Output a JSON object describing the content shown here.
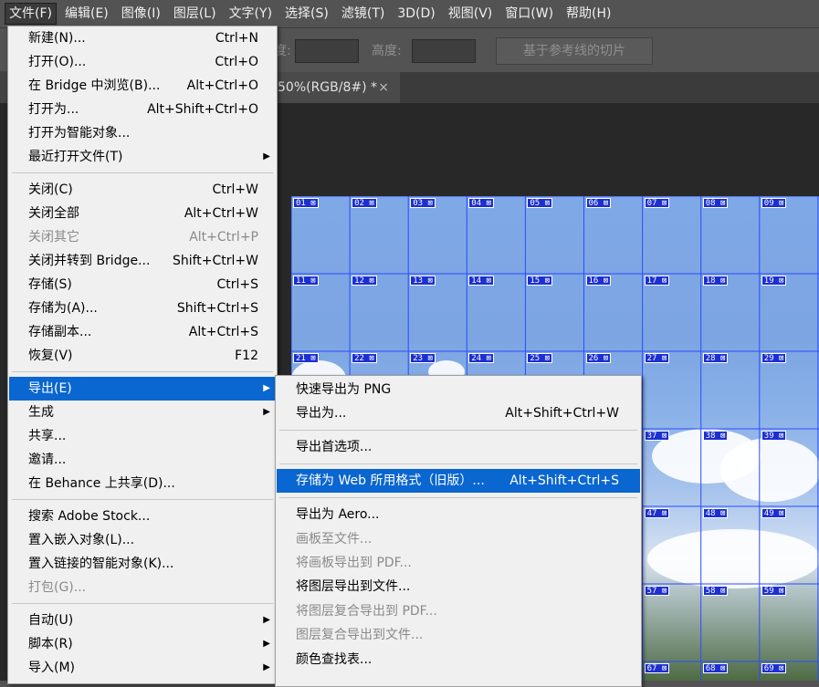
{
  "menubar": {
    "items": [
      {
        "label": "文件(F)",
        "active": true
      },
      {
        "label": "编辑(E)"
      },
      {
        "label": "图像(I)"
      },
      {
        "label": "图层(L)"
      },
      {
        "label": "文字(Y)"
      },
      {
        "label": "选择(S)"
      },
      {
        "label": "滤镜(T)"
      },
      {
        "label": "3D(D)"
      },
      {
        "label": "视图(V)"
      },
      {
        "label": "窗口(W)"
      },
      {
        "label": "帮助(H)"
      }
    ]
  },
  "options": {
    "width_label_fragment": "度:",
    "height_label": "高度:",
    "slice_button": "基于参考线的切片"
  },
  "tab": {
    "title": "50%(RGB/8#) *",
    "close": "×"
  },
  "file_menu": {
    "items": [
      {
        "label": "新建(N)...",
        "shortcut": "Ctrl+N"
      },
      {
        "label": "打开(O)...",
        "shortcut": "Ctrl+O"
      },
      {
        "label": "在 Bridge 中浏览(B)...",
        "shortcut": "Alt+Ctrl+O"
      },
      {
        "label": "打开为...",
        "shortcut": "Alt+Shift+Ctrl+O"
      },
      {
        "label": "打开为智能对象...",
        "shortcut": ""
      },
      {
        "label": "最近打开文件(T)",
        "shortcut": "",
        "submenu": true
      },
      {
        "sep": true
      },
      {
        "label": "关闭(C)",
        "shortcut": "Ctrl+W"
      },
      {
        "label": "关闭全部",
        "shortcut": "Alt+Ctrl+W"
      },
      {
        "label": "关闭其它",
        "shortcut": "Alt+Ctrl+P",
        "disabled": true
      },
      {
        "label": "关闭并转到 Bridge...",
        "shortcut": "Shift+Ctrl+W"
      },
      {
        "label": "存储(S)",
        "shortcut": "Ctrl+S"
      },
      {
        "label": "存储为(A)...",
        "shortcut": "Shift+Ctrl+S"
      },
      {
        "label": "存储副本...",
        "shortcut": "Alt+Ctrl+S"
      },
      {
        "label": "恢复(V)",
        "shortcut": "F12"
      },
      {
        "sep": true
      },
      {
        "label": "导出(E)",
        "shortcut": "",
        "submenu": true,
        "highlighted": true
      },
      {
        "label": "生成",
        "shortcut": "",
        "submenu": true
      },
      {
        "label": "共享...",
        "shortcut": ""
      },
      {
        "label": "邀请...",
        "shortcut": ""
      },
      {
        "label": "在 Behance 上共享(D)...",
        "shortcut": ""
      },
      {
        "sep": true
      },
      {
        "label": "搜索 Adobe Stock...",
        "shortcut": ""
      },
      {
        "label": "置入嵌入对象(L)...",
        "shortcut": ""
      },
      {
        "label": "置入链接的智能对象(K)...",
        "shortcut": ""
      },
      {
        "label": "打包(G)...",
        "shortcut": "",
        "disabled": true
      },
      {
        "sep": true
      },
      {
        "label": "自动(U)",
        "shortcut": "",
        "submenu": true
      },
      {
        "label": "脚本(R)",
        "shortcut": "",
        "submenu": true
      },
      {
        "label": "导入(M)",
        "shortcut": "",
        "submenu": true
      }
    ]
  },
  "export_menu": {
    "items": [
      {
        "label": "快速导出为 PNG",
        "shortcut": ""
      },
      {
        "label": "导出为...",
        "shortcut": "Alt+Shift+Ctrl+W"
      },
      {
        "sep": true
      },
      {
        "label": "导出首选项...",
        "shortcut": ""
      },
      {
        "sep": true
      },
      {
        "label": "存储为 Web 所用格式（旧版）...",
        "shortcut": "Alt+Shift+Ctrl+S",
        "highlighted": true
      },
      {
        "sep": true
      },
      {
        "label": "导出为 Aero...",
        "shortcut": ""
      },
      {
        "label": "画板至文件...",
        "shortcut": "",
        "disabled": true
      },
      {
        "label": "将画板导出到 PDF...",
        "shortcut": "",
        "disabled": true
      },
      {
        "label": "将图层导出到文件...",
        "shortcut": ""
      },
      {
        "label": "将图层复合导出到 PDF...",
        "shortcut": "",
        "disabled": true
      },
      {
        "label": "图层复合导出到文件...",
        "shortcut": "",
        "disabled": true
      },
      {
        "label": "颜色查找表...",
        "shortcut": ""
      }
    ]
  },
  "slices": {
    "visible_labels": [
      "01",
      "02",
      "03",
      "04",
      "05",
      "06",
      "07",
      "08",
      "09",
      "11",
      "12",
      "13",
      "14",
      "15",
      "16",
      "17",
      "18",
      "19",
      "21",
      "22",
      "23",
      "24",
      "25",
      "26",
      "27",
      "28",
      "29",
      "37",
      "38",
      "39",
      "47",
      "48",
      "49",
      "57",
      "58",
      "59",
      "67",
      "68",
      "69"
    ]
  },
  "colors": {
    "menu_highlight": "#0a66d0",
    "slice_badge": "#1c2fd0",
    "guide_line": "#2b4cff"
  }
}
